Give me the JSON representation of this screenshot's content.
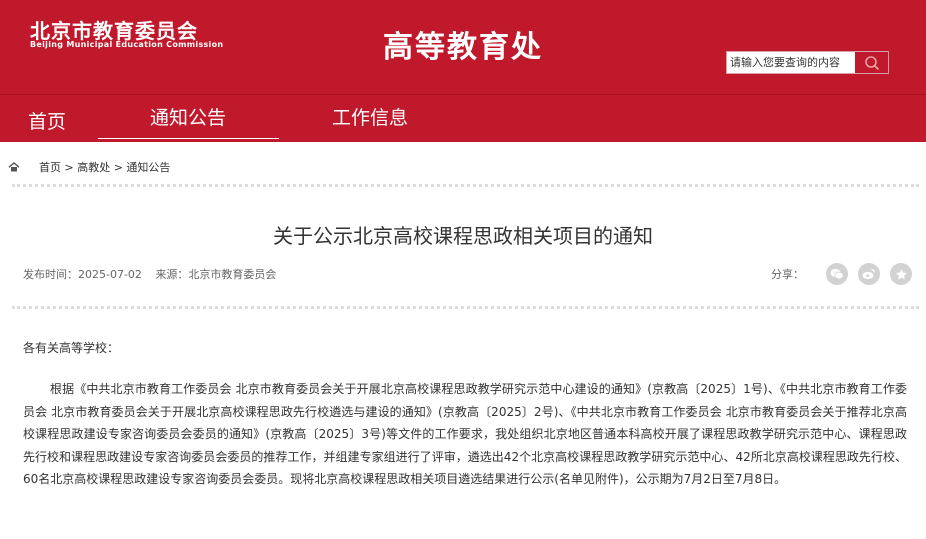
{
  "header": {
    "logo_cn": "北京市教育委员会",
    "logo_en": "Beijing Municipal Education Commission",
    "site_title": "高等教育处",
    "search_placeholder": "请输入您要查询的内容",
    "search_icon": "search-icon"
  },
  "nav": {
    "items": [
      {
        "label": "首页"
      },
      {
        "label": "通知公告",
        "active": true
      },
      {
        "label": "工作信息"
      }
    ]
  },
  "breadcrumb": {
    "icon": "home-icon",
    "text": "首页 > 高教处 > 通知公告"
  },
  "article": {
    "title": "关于公示北京高校课程思政相关项目的通知",
    "publish_time": "发布时间：2025-07-02",
    "source": "来源：北京市教育委员会",
    "share_label": "分享：",
    "share_icons": [
      "wechat-icon",
      "weibo-icon",
      "favorite-icon"
    ],
    "salutation": "各有关高等学校：",
    "paragraph": "根据《中共北京市教育工作委员会 北京市教育委员会关于开展北京高校课程思政教学研究示范中心建设的通知》(京教高〔2025〕1号)、《中共北京市教育工作委员会 北京市教育委员会关于开展北京高校课程思政先行校遴选与建设的通知》(京教高〔2025〕2号)、《中共北京市教育工作委员会 北京市教育委员会关于推荐北京高校课程思政建设专家咨询委员会委员的通知》(京教高〔2025〕3号)等文件的工作要求，我处组织北京地区普通本科高校开展了课程思政教学研究示范中心、课程思政先行校和课程思政建设专家咨询委员会委员的推荐工作，并组建专家组进行了评审，遴选出42个北京高校课程思政教学研究示范中心、42所北京高校课程思政先行校、60名北京高校课程思政建设专家咨询委员会委员。现将北京高校课程思政相关项目遴选结果进行公示(名单见附件)，公示期为7月2日至7月8日。"
  },
  "colors": {
    "brand_red": "#c0192b",
    "text": "#333333",
    "meta_text": "#666666",
    "share_icon_bg": "#d2d2d2"
  }
}
